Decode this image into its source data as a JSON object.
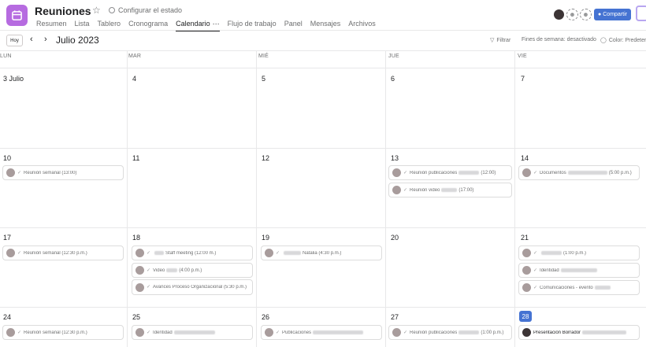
{
  "project": {
    "title": "Reuniones",
    "status": "Configurar el estado"
  },
  "tabs": [
    "Resumen",
    "Lista",
    "Tablero",
    "Cronograma",
    "Calendario",
    "Flujo de trabajo",
    "Panel",
    "Mensajes",
    "Archivos"
  ],
  "share_label": "Compartir",
  "toolbar": {
    "today": "Hoy",
    "month": "Julio 2023",
    "filter": "Filtrar",
    "weekends": "Fines de semana: desactivado",
    "color": "Color: Predeterm"
  },
  "weekdays": [
    "LUN",
    "MAR",
    "MIÉ",
    "JUE",
    "VIE"
  ],
  "weeks": [
    [
      "3 Julio",
      "4",
      "5",
      "6",
      "7"
    ],
    [
      "10",
      "11",
      "12",
      "13",
      "14"
    ],
    [
      "17",
      "18",
      "19",
      "20",
      "21"
    ],
    [
      "24",
      "25",
      "26",
      "27",
      "28"
    ]
  ],
  "events": {
    "w1_mon": "Reunión semanal (13:00)",
    "w1_thu_1a": "Reunión publicaciones",
    "w1_thu_1b": "(12:00)",
    "w1_thu_2a": "Reunión video",
    "w1_thu_2b": "(17:00)",
    "w1_fri_a": "Documentos",
    "w1_fri_b": "(5:00 p.m.)",
    "w2_mon": "Reunión semanal (12:30 p.m.)",
    "w2_tue_1": "Staff meeting (12:00 m.)",
    "w2_tue_2a": "Video",
    "w2_tue_2b": "(4:00 p.m.)",
    "w2_tue_3": "Avances Proceso Organizacional (5:30 p.m.)",
    "w2_wed": "Natalia (4:30 p.m.)",
    "w2_fri_1": "(1:00 p.m.)",
    "w2_fri_2": "Identidad",
    "w2_fri_3": "Comunicaciones - evento",
    "w3_mon": "Reunión semanal (12:30 p.m.)",
    "w3_tue": "Identidad",
    "w3_wed": "Publicaciones",
    "w3_thu_a": "Reunión publicaciones",
    "w3_thu_b": "(1:00 p.m.)",
    "w3_fri": "Presentación Borrador"
  }
}
